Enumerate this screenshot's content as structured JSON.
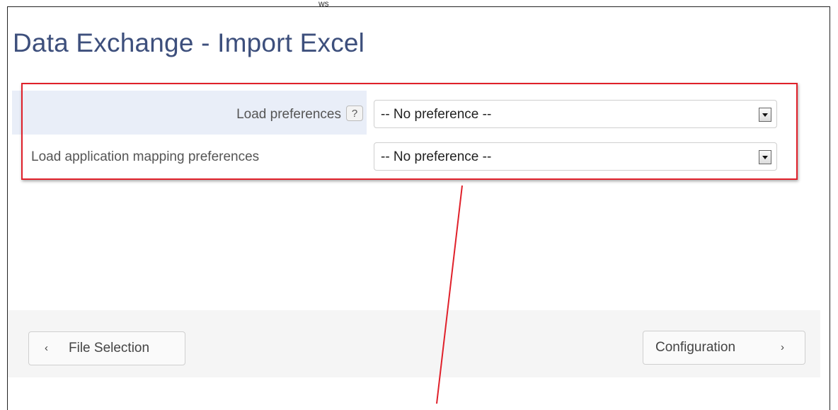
{
  "window": {
    "tick_mark": "ws"
  },
  "page": {
    "title": "Data Exchange - Import Excel"
  },
  "preferences": {
    "load_label": "Load preferences",
    "help_label": "?",
    "load_value": "-- No preference --",
    "mapping_label": "Load application mapping preferences",
    "mapping_value": "-- No preference --"
  },
  "navigation": {
    "back_icon": "‹",
    "back_label": "File Selection",
    "next_label": "Configuration",
    "next_icon": "›"
  },
  "colors": {
    "title": "#3d4f7c",
    "highlight": "#e0202a",
    "row_background": "#e9eef8",
    "footer_background": "#f5f5f5"
  },
  "icons": {
    "help": "question-mark-icon",
    "dropdown": "chevron-down-icon",
    "back": "chevron-left-icon",
    "next": "chevron-right-icon"
  }
}
